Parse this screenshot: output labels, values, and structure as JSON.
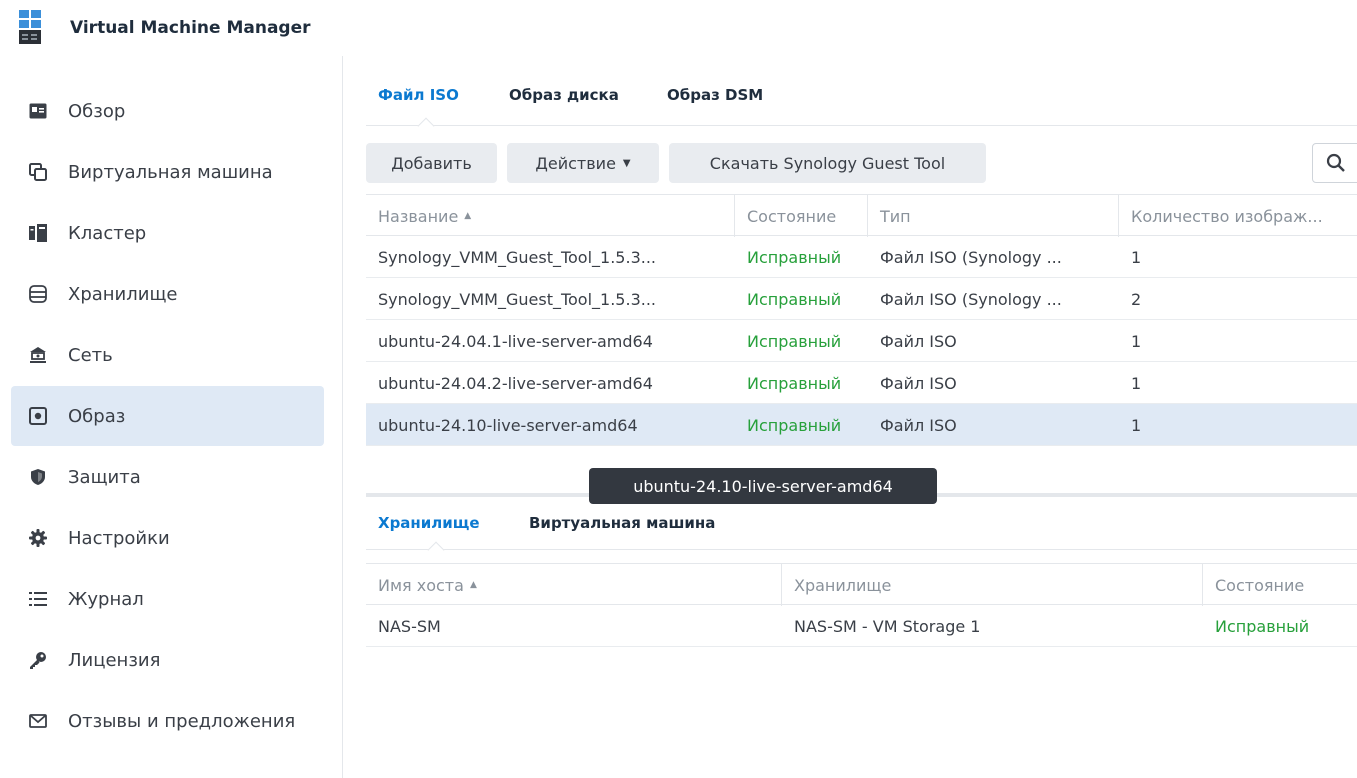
{
  "app": {
    "title": "Virtual Machine Manager"
  },
  "sidebar": {
    "items": [
      {
        "label": "Обзор",
        "icon": "overview-icon"
      },
      {
        "label": "Виртуальная машина",
        "icon": "virtual-machine-icon"
      },
      {
        "label": "Кластер",
        "icon": "cluster-icon"
      },
      {
        "label": "Хранилище",
        "icon": "storage-icon"
      },
      {
        "label": "Сеть",
        "icon": "network-icon"
      },
      {
        "label": "Образ",
        "icon": "image-icon",
        "active": true
      },
      {
        "label": "Защита",
        "icon": "shield-icon"
      },
      {
        "label": "Настройки",
        "icon": "gear-icon"
      },
      {
        "label": "Журнал",
        "icon": "log-list-icon"
      },
      {
        "label": "Лицензия",
        "icon": "key-icon"
      },
      {
        "label": "Отзывы и предложения",
        "icon": "envelope-icon"
      }
    ]
  },
  "main": {
    "tabs": [
      {
        "label": "Файл ISO",
        "active": true
      },
      {
        "label": "Образ диска"
      },
      {
        "label": "Образ DSM"
      }
    ],
    "toolbar": {
      "add_label": "Добавить",
      "action_label": "Действие",
      "download_label": "Скачать Synology Guest Tool"
    },
    "table": {
      "columns": [
        "Название",
        "Состояние",
        "Тип",
        "Количество изображ..."
      ],
      "rows": [
        {
          "name": "Synology_VMM_Guest_Tool_1.5.3...",
          "status": "Исправный",
          "type": "Файл ISO (Synology ...",
          "count": "1"
        },
        {
          "name": "Synology_VMM_Guest_Tool_1.5.3...",
          "status": "Исправный",
          "type": "Файл ISO (Synology ...",
          "count": "2"
        },
        {
          "name": "ubuntu-24.04.1-live-server-amd64",
          "status": "Исправный",
          "type": "Файл ISO",
          "count": "1"
        },
        {
          "name": "ubuntu-24.04.2-live-server-amd64",
          "status": "Исправный",
          "type": "Файл ISO",
          "count": "1"
        },
        {
          "name": "ubuntu-24.10-live-server-amd64",
          "status": "Исправный",
          "type": "Файл ISO",
          "count": "1",
          "selected": true
        }
      ]
    },
    "tooltip": "ubuntu-24.10-live-server-amd64",
    "detail": {
      "tabs": [
        {
          "label": "Хранилище",
          "active": true
        },
        {
          "label": "Виртуальная машина"
        }
      ],
      "columns": [
        "Имя хоста",
        "Хранилище",
        "Состояние"
      ],
      "rows": [
        {
          "host": "NAS-SM",
          "storage": "NAS-SM - VM Storage 1",
          "status": "Исправный"
        }
      ]
    }
  },
  "colors": {
    "accent": "#0b79d0",
    "ok": "#27a03b",
    "selected_bg": "#dfe9f5"
  }
}
